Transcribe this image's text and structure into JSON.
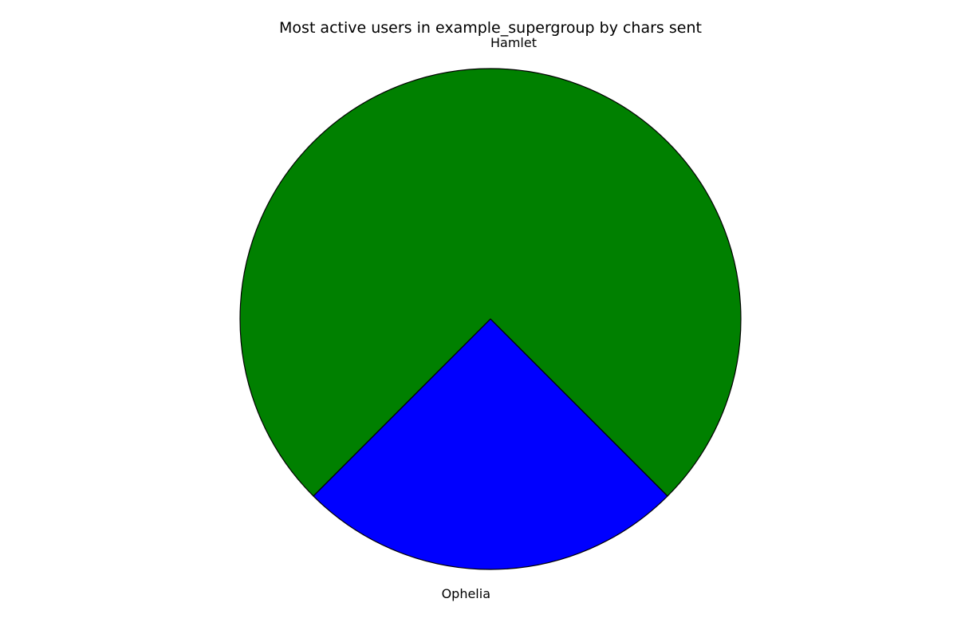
{
  "chart_data": {
    "type": "pie",
    "title": "Most active users in example_supergroup by chars sent",
    "labels": [
      "Hamlet",
      "Ophelia"
    ],
    "values": [
      75,
      25
    ],
    "colors": [
      "#008000",
      "#0000ff"
    ],
    "edge_color": "#000000",
    "start_angle_degrees": 315,
    "direction": "counterclockwise",
    "legend": "none",
    "grid": false
  }
}
